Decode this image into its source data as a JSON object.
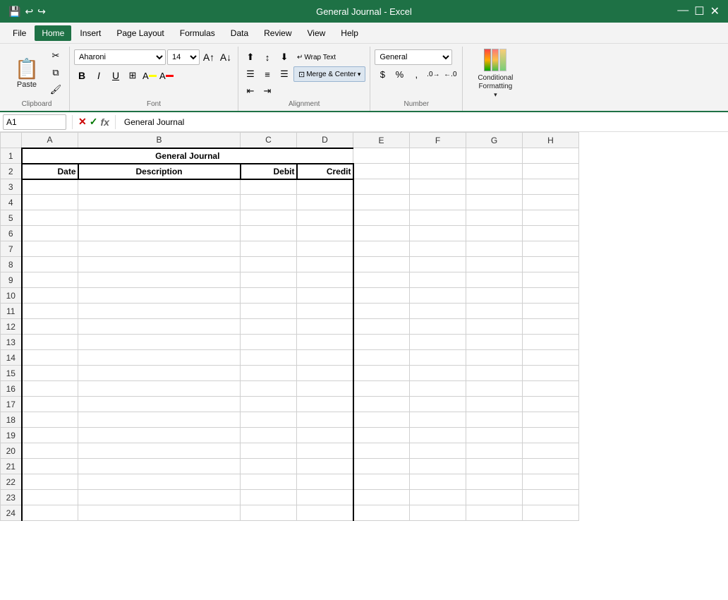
{
  "topbar": {
    "title": "General Journal - Excel",
    "quick_access": [
      "💾",
      "↩",
      "↪"
    ],
    "window_controls": [
      "—",
      "☐",
      "✕"
    ]
  },
  "menu": {
    "items": [
      "File",
      "Home",
      "Insert",
      "Page Layout",
      "Formulas",
      "Data",
      "Review",
      "View",
      "Help"
    ],
    "active": "Home"
  },
  "ribbon": {
    "clipboard": {
      "label": "Clipboard",
      "paste_label": "Paste"
    },
    "font": {
      "label": "Font",
      "font_name": "Aharoni",
      "font_size": "14",
      "bold": "B",
      "italic": "I",
      "underline": "U"
    },
    "alignment": {
      "label": "Alignment",
      "wrap_text": "Wrap Text",
      "merge_center": "Merge & Center"
    },
    "number": {
      "label": "Number",
      "format": "General"
    },
    "conditional": {
      "label": "Conditional Formatting"
    }
  },
  "formula_bar": {
    "cell_ref": "A1",
    "formula": "General Journal"
  },
  "sheet": {
    "col_headers": [
      "",
      "A",
      "B",
      "C",
      "D",
      "E",
      "F",
      "G",
      "H"
    ],
    "row_count": 24,
    "title_row": 1,
    "title_text": "General Journal",
    "header_row": 2,
    "headers": {
      "date": "Date",
      "description": "Description",
      "debit": "Debit",
      "credit": "Credit"
    }
  }
}
